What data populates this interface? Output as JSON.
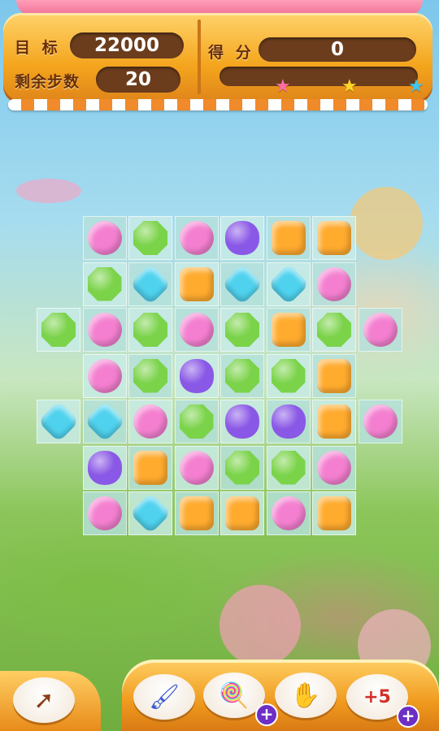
{
  "hud": {
    "target_label": "目 标",
    "target_value": "22000",
    "moves_label": "剩余步数",
    "moves_value": "20",
    "score_label": "得 分",
    "score_value": "0",
    "progress_fraction": 0,
    "stars": [
      "pink-star",
      "yellow-star",
      "blue-star"
    ]
  },
  "colors": {
    "pink": "#f47fd0",
    "green": "#7bd34a",
    "purple": "#8a58e6",
    "orange": "#ffab2e",
    "blue": "#4fd2ee"
  },
  "board": {
    "rows": [
      [
        null,
        "pink",
        "green",
        "pink",
        "purple",
        "orange",
        "orange",
        null
      ],
      [
        null,
        "green",
        "blue",
        "orange",
        "blue",
        "blue",
        "pink",
        null
      ],
      [
        "green",
        "pink",
        "green",
        "pink",
        "green",
        "orange",
        "green",
        "pink"
      ],
      [
        null,
        "pink",
        "green",
        "purple",
        "green",
        "green",
        "orange",
        null
      ],
      [
        "blue",
        "blue",
        "pink",
        "green",
        "purple",
        "purple",
        "orange",
        "pink"
      ],
      [
        null,
        "purple",
        "orange",
        "pink",
        "green",
        "green",
        "pink",
        null
      ],
      [
        null,
        "pink",
        "blue",
        "orange",
        "orange",
        "pink",
        "orange",
        null
      ]
    ]
  },
  "boosters": [
    {
      "name": "back-arrow-icon",
      "plus": false
    },
    {
      "name": "paintbrush-icon",
      "plus": false
    },
    {
      "name": "lollipop-icon",
      "plus": true
    },
    {
      "name": "hand-icon",
      "plus": false
    },
    {
      "name": "plus-five-moves-icon",
      "plus": true,
      "text": "+5"
    }
  ]
}
